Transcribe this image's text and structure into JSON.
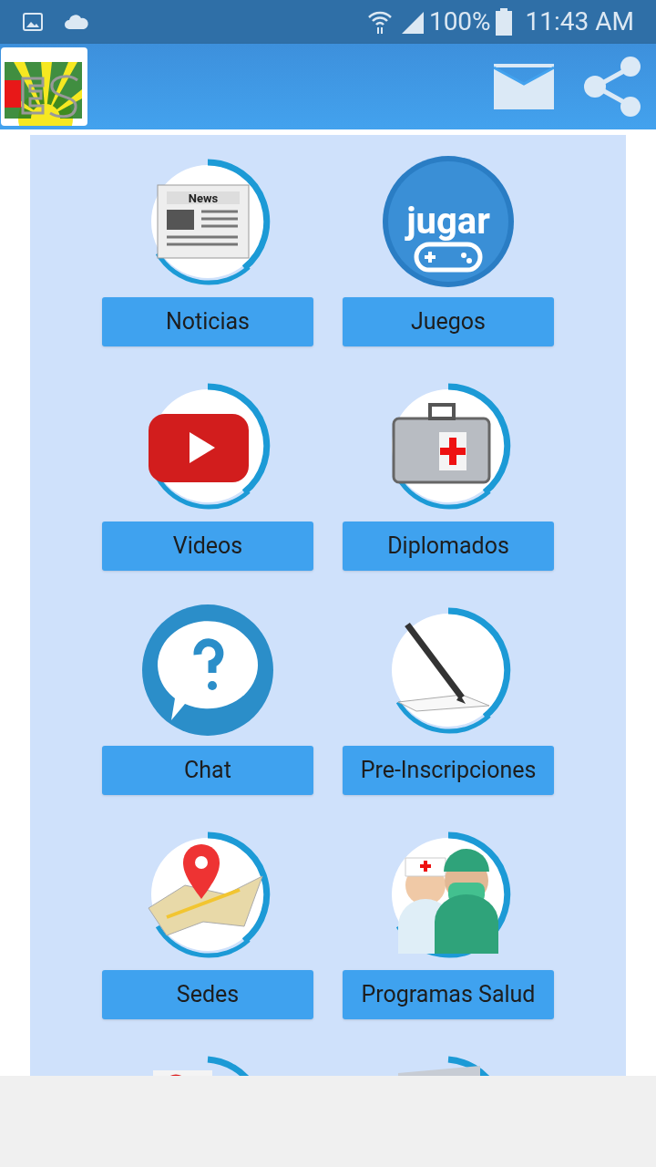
{
  "status_bar": {
    "battery": "100%",
    "time": "11:43 AM"
  },
  "menu": [
    {
      "label": "Noticias",
      "icon_text": "News"
    },
    {
      "label": "Juegos",
      "icon_text": "jugar"
    },
    {
      "label": "Videos"
    },
    {
      "label": "Diplomados"
    },
    {
      "label": "Chat"
    },
    {
      "label": "Pre-Inscripciones"
    },
    {
      "label": "Sedes"
    },
    {
      "label": "Programas Salud"
    }
  ]
}
